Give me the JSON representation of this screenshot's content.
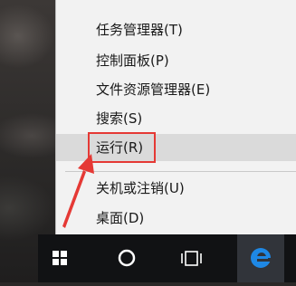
{
  "context_menu": {
    "items": [
      {
        "label": "任务管理器(T)"
      },
      {
        "label": "控制面板(P)"
      },
      {
        "label": "文件资源管理器(E)"
      },
      {
        "label": "搜索(S)"
      },
      {
        "label": "运行(R)"
      },
      {
        "label": "关机或注销(U)"
      },
      {
        "label": "桌面(D)"
      }
    ],
    "hovered_item": "运行(R)"
  },
  "annotation": {
    "highlight_color": "#e53935"
  },
  "taskbar": {
    "buttons": [
      {
        "icon": "windows-start-icon"
      },
      {
        "icon": "cortana-circle-icon"
      },
      {
        "icon": "task-view-icon"
      },
      {
        "icon": "edge-browser-icon"
      }
    ]
  }
}
